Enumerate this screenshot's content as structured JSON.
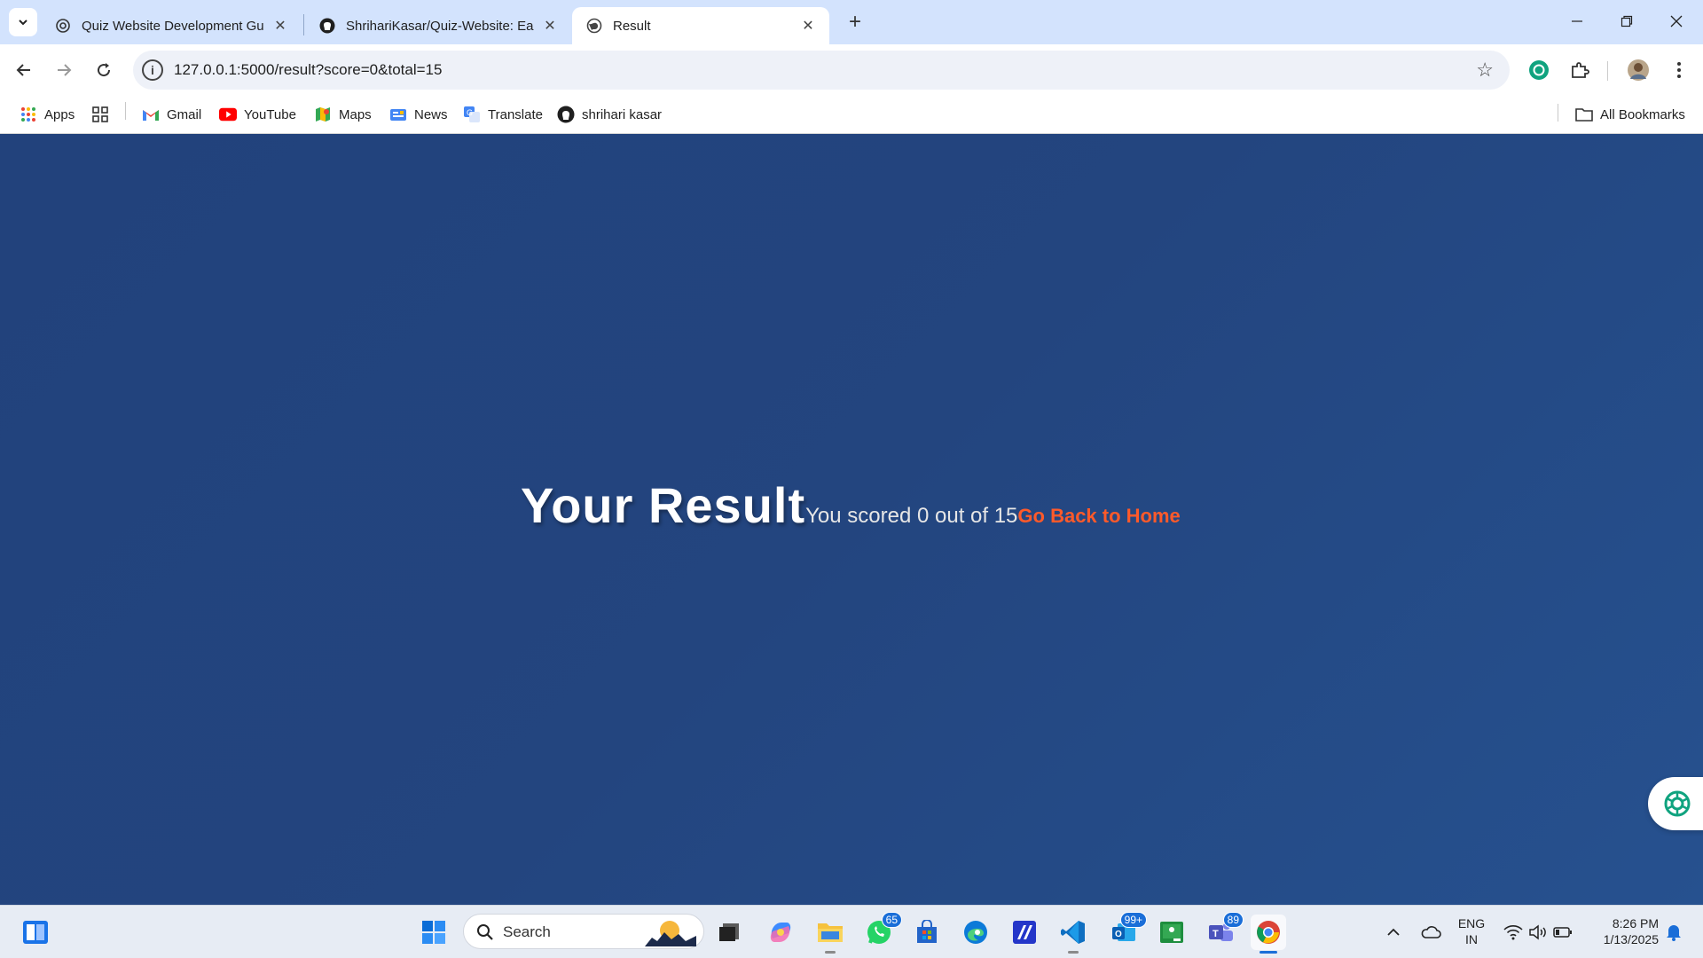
{
  "browser": {
    "tabs": [
      {
        "title": "Quiz Website Development Gui",
        "icon": "chatgpt-icon"
      },
      {
        "title": "ShrihariKasar/Quiz-Website: Ea",
        "icon": "github-icon"
      },
      {
        "title": "Result",
        "icon": "globe-icon",
        "active": true
      }
    ],
    "url": "127.0.0.1:5000/result?score=0&total=15",
    "bookmarks": [
      {
        "label": "Apps",
        "icon": "apps-grid-icon"
      },
      {
        "label": "Gmail",
        "icon": "gmail-icon"
      },
      {
        "label": "YouTube",
        "icon": "youtube-icon"
      },
      {
        "label": "Maps",
        "icon": "maps-icon"
      },
      {
        "label": "News",
        "icon": "news-icon"
      },
      {
        "label": "Translate",
        "icon": "translate-icon"
      },
      {
        "label": "shrihari kasar",
        "icon": "github-icon"
      }
    ],
    "all_bookmarks_label": "All Bookmarks"
  },
  "page": {
    "title": "Your Result",
    "score_text": "You scored 0 out of 15",
    "home_link": "Go Back to Home",
    "colors": {
      "background": "#23447f",
      "link": "#ff5a2a"
    }
  },
  "taskbar": {
    "search_placeholder": "Search",
    "badges": {
      "whatsapp": "65",
      "mail": "99+",
      "teams": "89"
    },
    "language": {
      "line1": "ENG",
      "line2": "IN"
    },
    "time": "8:26 PM",
    "date": "1/13/2025"
  }
}
